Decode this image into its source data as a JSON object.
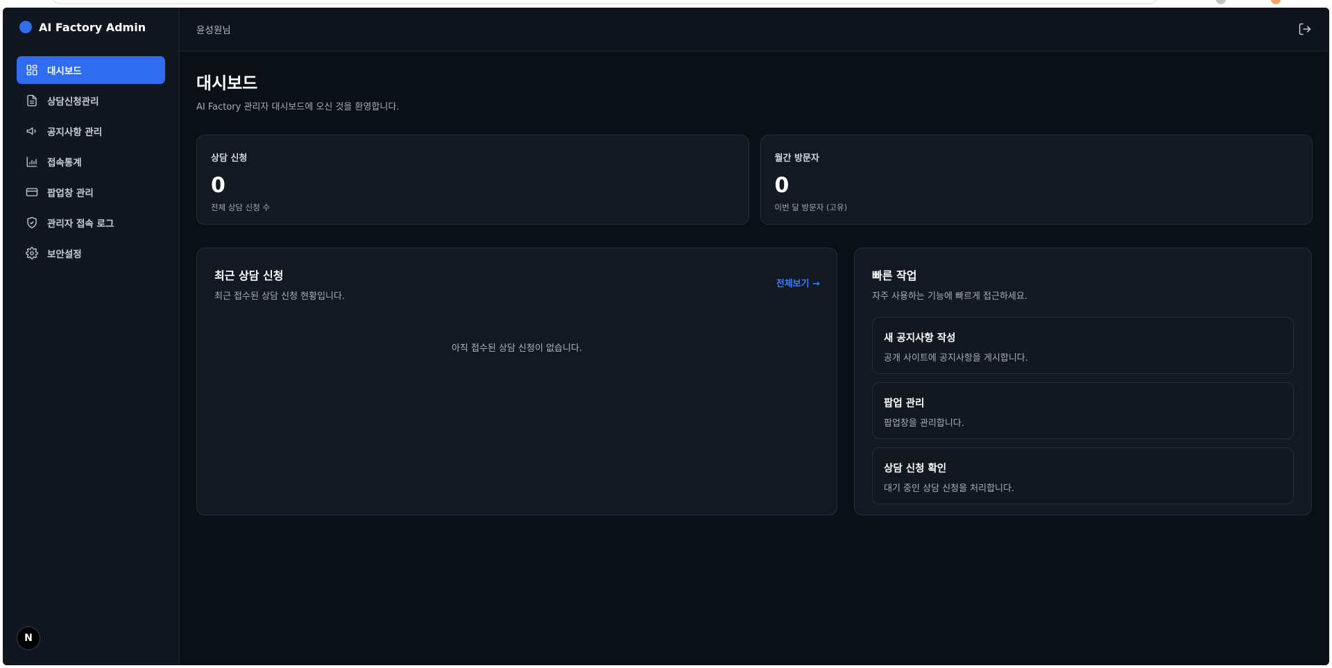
{
  "app": {
    "title": "AI Factory Admin"
  },
  "sidebar": {
    "items": [
      {
        "label": "대시보드",
        "icon": "dashboard-grid-icon",
        "active": true
      },
      {
        "label": "상담신청관리",
        "icon": "document-icon",
        "active": false
      },
      {
        "label": "공지사항 관리",
        "icon": "megaphone-icon",
        "active": false
      },
      {
        "label": "접속통계",
        "icon": "bar-chart-icon",
        "active": false
      },
      {
        "label": "팝업창 관리",
        "icon": "window-card-icon",
        "active": false
      },
      {
        "label": "관리자 접속 로그",
        "icon": "shield-check-icon",
        "active": false
      },
      {
        "label": "보안설정",
        "icon": "gear-icon",
        "active": false
      }
    ],
    "badge": "N"
  },
  "header": {
    "user": "윤성원님",
    "logout_icon": "logout-icon"
  },
  "page": {
    "title": "대시보드",
    "subtitle": "AI Factory 관리자 대시보드에 오신 것을 환영합니다."
  },
  "stats": [
    {
      "label": "상담 신청",
      "value": "0",
      "desc": "전체 상담 신청 수"
    },
    {
      "label": "월간 방문자",
      "value": "0",
      "desc": "이번 달 방문자 (고유)"
    }
  ],
  "recent": {
    "title": "최근 상담 신청",
    "subtitle": "최근 접수된 상담 신청 현황입니다.",
    "view_all": "전체보기 →",
    "empty": "아직 접수된 상담 신청이 없습니다."
  },
  "quick": {
    "title": "빠른 작업",
    "subtitle": "자주 사용하는 기능에 빠르게 접근하세요.",
    "items": [
      {
        "title": "새 공지사항 작성",
        "desc": "공개 사이트에 공지사항을 게시합니다."
      },
      {
        "title": "팝업 관리",
        "desc": "팝업창을 관리합니다."
      },
      {
        "title": "상담 신청 확인",
        "desc": "대기 중인 상담 신청을 처리합니다."
      }
    ]
  },
  "colors": {
    "accent": "#2f6cf0",
    "background": "#0b0f16",
    "link": "#3b7cf7"
  }
}
